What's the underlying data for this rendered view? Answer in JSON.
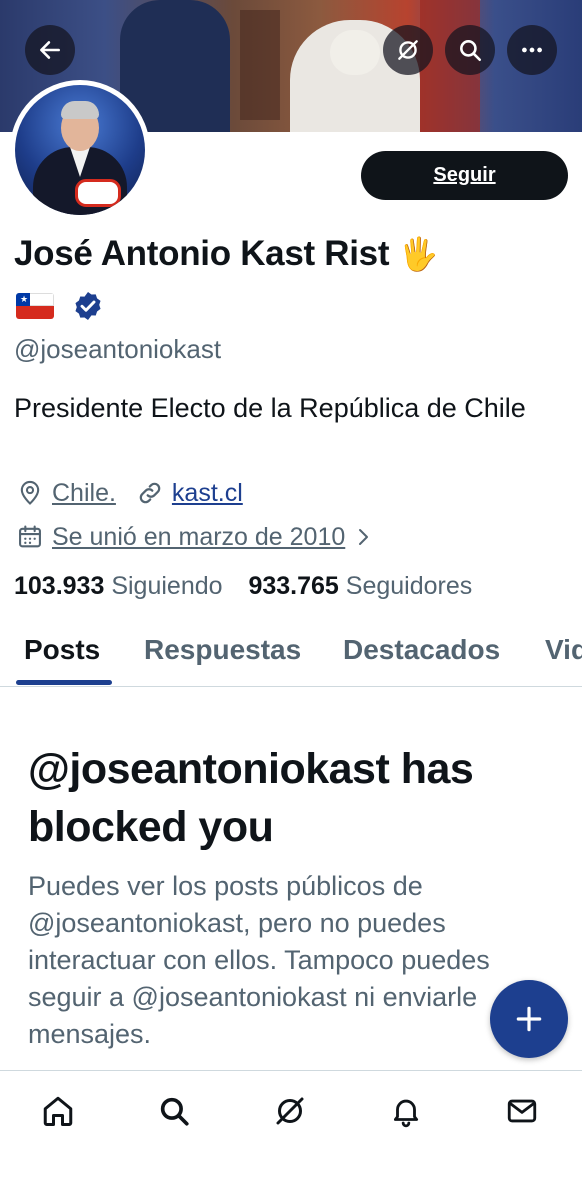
{
  "profile": {
    "name": "José Antonio Kast Rist",
    "name_emoji": "🖐",
    "flag_emoji": "🇨🇱",
    "handle": "@joseantoniokast",
    "bio": "Presidente Electo de la República de Chile",
    "location": "Chile.",
    "website": "kast.cl",
    "joined": "Se unió en marzo de 2010",
    "following_count": "103.933",
    "following_label": "Siguiendo",
    "followers_count": "933.765",
    "followers_label": "Seguidores"
  },
  "actions": {
    "follow_label": "Seguir"
  },
  "tabs": [
    {
      "label": "Posts"
    },
    {
      "label": "Respuestas"
    },
    {
      "label": "Destacados"
    },
    {
      "label": "Vid"
    }
  ],
  "blocked": {
    "title": "@joseantoniokast has blocked you",
    "body": "Puedes ver los posts públicos de @joseantoniokast, pero no puedes interactuar con ellos. Tampoco puedes seguir a @joseantoniokast ni enviarle mensajes."
  },
  "icons": {
    "back": "arrow-left-icon",
    "grok": "grok-icon",
    "search": "search-icon",
    "more": "more-icon",
    "verified": "verified-badge-icon",
    "location": "location-pin-icon",
    "link": "link-icon",
    "calendar": "calendar-icon",
    "chevron": "chevron-right-icon",
    "compose": "plus-icon",
    "nav": [
      "home-icon",
      "search-icon",
      "grok-icon",
      "notifications-bell-icon",
      "messages-mail-icon"
    ]
  },
  "colors": {
    "accent": "#1d3f8f",
    "text": "#0f1419",
    "secondary": "#536471",
    "follow_bg": "#0f1419"
  }
}
